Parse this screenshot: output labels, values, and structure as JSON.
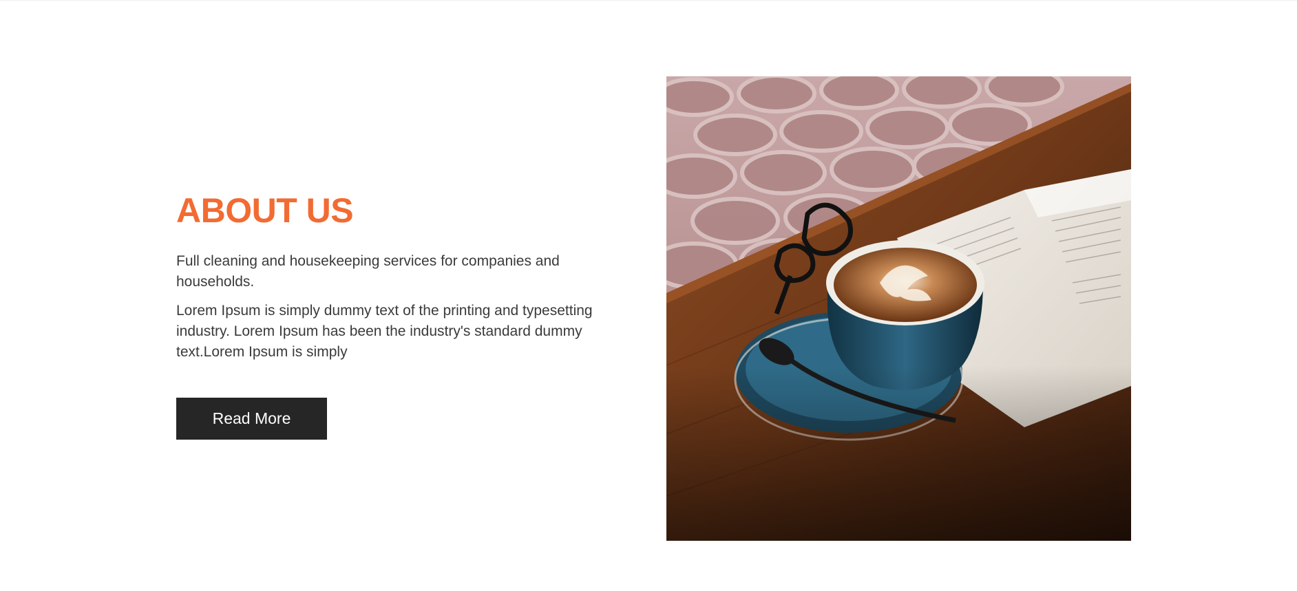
{
  "about": {
    "title": "ABOUT US",
    "lead": "Full cleaning and housekeeping services for companies and households.",
    "body": "Lorem Ipsum is simply dummy text of the printing and typesetting industry. Lorem Ipsum has been the industry's standard dummy text.Lorem Ipsum is simply",
    "button_label": "Read More"
  },
  "colors": {
    "accent": "#f26b32",
    "button": "#262626",
    "text": "#3a3a3a"
  },
  "photo": {
    "subject": "coffee-cup-book-glasses-photo"
  }
}
